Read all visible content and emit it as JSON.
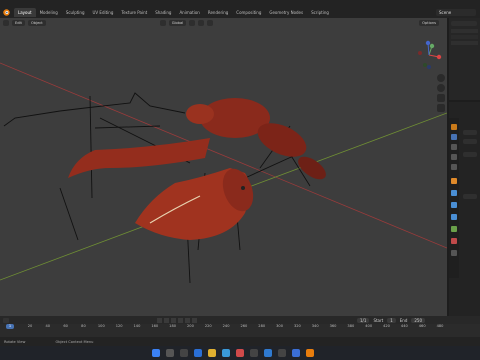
{
  "app": {
    "workspace_tabs": [
      "Layout",
      "Modeling",
      "Sculpting",
      "UV Editing",
      "Texture Paint",
      "Shading",
      "Animation",
      "Rendering",
      "Compositing",
      "Geometry Nodes",
      "Scripting"
    ],
    "active_tab": "Layout",
    "scene_name": "Scene"
  },
  "viewport": {
    "header_left": [
      "Edit",
      "Object"
    ],
    "orientation": "Global",
    "options_label": "Options"
  },
  "timeline": {
    "current_frame": "1",
    "ticks": [
      "20",
      "40",
      "60",
      "80",
      "100",
      "120",
      "140",
      "160",
      "180",
      "200",
      "220",
      "240",
      "260",
      "280",
      "300",
      "320",
      "340",
      "360",
      "380",
      "400",
      "420",
      "440",
      "460",
      "480"
    ],
    "start_label": "Start",
    "start_value": "1",
    "end_label": "End",
    "end_value": "250",
    "frame_label": "1/1"
  },
  "status": {
    "left": "Rotate View",
    "right": "Object Context Menu"
  },
  "colors": {
    "accent": "#4772b3",
    "x_axis": "#b13a3a",
    "y_axis": "#7c9a3a",
    "crayfish": "#8e2a1e"
  }
}
